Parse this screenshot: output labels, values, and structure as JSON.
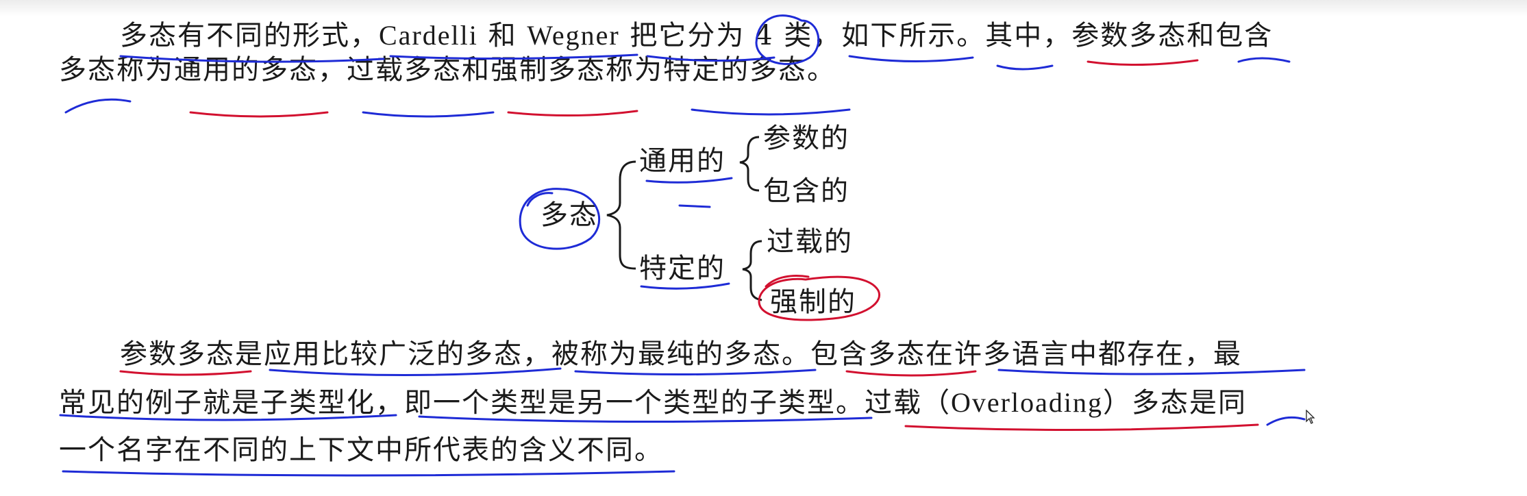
{
  "paragraph1": {
    "line1_a": "多态有不同的形式，",
    "line1_b": "Cardelli",
    "line1_c": " 和 ",
    "line1_d": "Wegner",
    "line1_e": " 把它分为 4 类，如下所示。其中，参数多态和包含",
    "line2": "多态称为通用的多态，过载多态和强制多态称为特定的多态。"
  },
  "tree": {
    "root": "多态",
    "branches": [
      {
        "label": "通用的",
        "children": [
          "参数的",
          "包含的"
        ]
      },
      {
        "label": "特定的",
        "children": [
          "过载的",
          "强制的"
        ]
      }
    ]
  },
  "paragraph2": {
    "line1": "参数多态是应用比较广泛的多态，被称为最纯的多态。包含多态在许多语言中都存在，最",
    "line2_a": "常见的例子就是子类型化，即一个类型是另一个类型的子类型。过载（",
    "line2_b": "Overloading",
    "line2_c": "）多态是同",
    "line3": "一个名字在不同的上下文中所代表的含义不同。"
  },
  "colors": {
    "text": "#1a1a1a",
    "annotation_blue": "#1e2bd6",
    "annotation_red": "#d2102f"
  },
  "icons": [
    "mouse-cursor-icon"
  ]
}
